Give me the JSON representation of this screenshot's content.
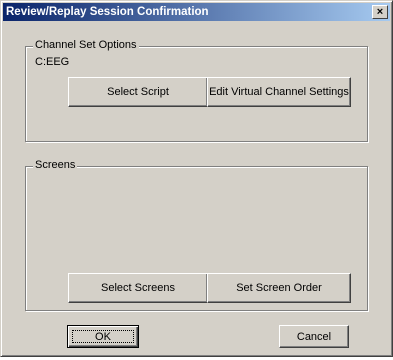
{
  "window": {
    "title": "Review/Replay Session Confirmation",
    "close_label": "×"
  },
  "channel_set": {
    "legend": "Channel Set Options",
    "value": "C:EEG",
    "select_script_label": "Select Script",
    "edit_virtual_label": "Edit Virtual Channel Settings"
  },
  "screens": {
    "legend": "Screens",
    "select_screens_label": "Select Screens",
    "set_order_label": "Set Screen Order"
  },
  "footer": {
    "ok_label": "OK",
    "cancel_label": "Cancel"
  }
}
